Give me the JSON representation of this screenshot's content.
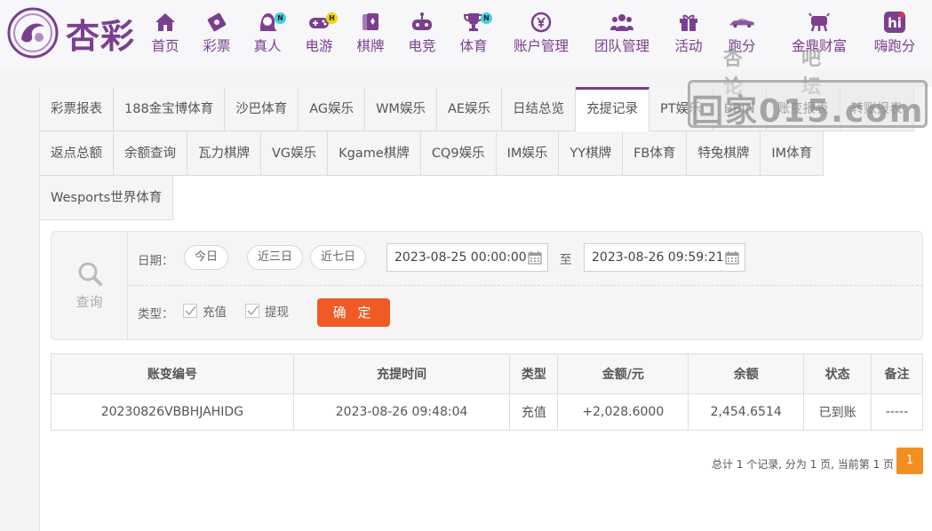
{
  "brand": {
    "name": "杏彩"
  },
  "nav": [
    {
      "id": "home",
      "label": "首页",
      "icon": "home-icon"
    },
    {
      "id": "lottery",
      "label": "彩票",
      "icon": "lottery-ticket-icon"
    },
    {
      "id": "live",
      "label": "真人",
      "icon": "dealer-icon",
      "badge": "N"
    },
    {
      "id": "egame",
      "label": "电游",
      "icon": "gamepad-icon",
      "badge": "H"
    },
    {
      "id": "chess",
      "label": "棋牌",
      "icon": "cards-icon"
    },
    {
      "id": "esports",
      "label": "电竞",
      "icon": "joystick-icon"
    },
    {
      "id": "sports",
      "label": "体育",
      "icon": "trophy-icon",
      "badge": "N"
    },
    {
      "id": "account",
      "label": "账户管理",
      "icon": "currency-icon"
    },
    {
      "id": "team",
      "label": "团队管理",
      "icon": "team-icon"
    },
    {
      "id": "events",
      "label": "活动",
      "icon": "gift-icon"
    },
    {
      "id": "race",
      "label": "跑分",
      "icon": "car-icon"
    },
    {
      "id": "wealth",
      "label": "金鼎财富",
      "icon": "tripod-icon"
    },
    {
      "id": "hirun",
      "label": "嗨跑分",
      "icon": "hi-icon"
    }
  ],
  "tabs": {
    "row1": [
      "彩票报表",
      "188金宝博体育",
      "沙巴体育",
      "AG娱乐",
      "WM娱乐",
      "AE娱乐",
      "日结总览",
      "充提记录",
      "PT娱乐",
      "BBIN",
      "账变报表",
      "转账报表"
    ],
    "row2": [
      "返点总额",
      "余额查询",
      "瓦力棋牌",
      "VG娱乐",
      "Kgame棋牌",
      "CQ9娱乐",
      "IM娱乐",
      "YY棋牌",
      "FB体育",
      "特兔棋牌",
      "IM体育"
    ],
    "row3": [
      "Wesports世界体育"
    ],
    "active": "充提记录"
  },
  "filter": {
    "search_label": "查询",
    "date_label": "日期：",
    "quick": [
      "今日",
      "近三日",
      "近七日"
    ],
    "start": "2023-08-25 00:00:00",
    "to": "至",
    "end": "2023-08-26 09:59:21",
    "type_label": "类型：",
    "types": [
      {
        "label": "充值",
        "checked": true
      },
      {
        "label": "提现",
        "checked": true
      }
    ],
    "confirm": "确 定"
  },
  "table": {
    "headers": [
      "账变编号",
      "充提时间",
      "类型",
      "金额/元",
      "余额",
      "状态",
      "备注"
    ],
    "rows": [
      [
        "20230826VBBHJAHIDG",
        "2023-08-26 09:48:04",
        "充值",
        "+2,028.6000",
        "2,454.6514",
        "已到账",
        "-----"
      ]
    ]
  },
  "pagination": {
    "summary": "总计 1 个记录, 分为 1 页, 当前第 1 页",
    "current": "1"
  },
  "watermark": {
    "top": "杏吧论坛",
    "main": "回家015.com"
  },
  "colors": {
    "brand": "#7a3f8f",
    "accent": "#f05a24",
    "amount": "#d0232b",
    "status_ok": "#3aa335",
    "page": "#f38e21"
  }
}
